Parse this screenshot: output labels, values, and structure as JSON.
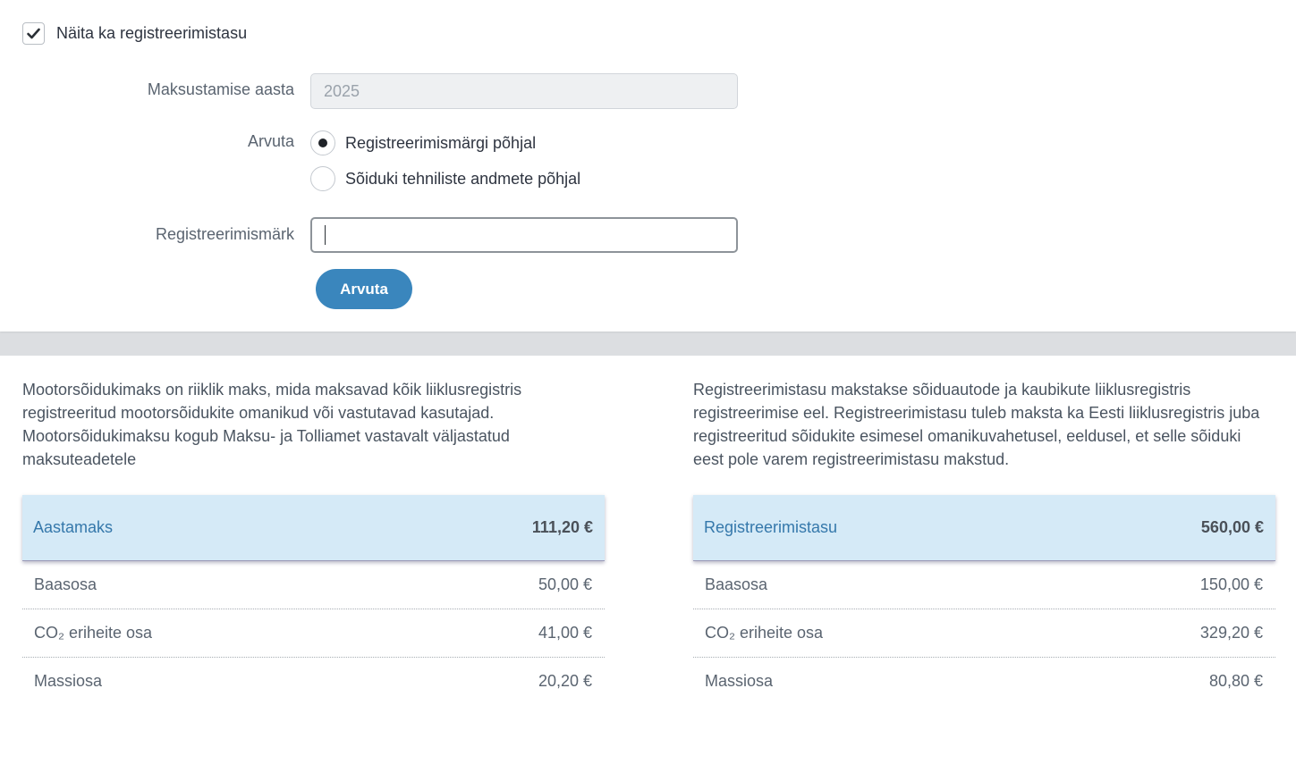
{
  "form": {
    "show_fee_checkbox": {
      "label": "Näita ka registreerimistasu",
      "checked": true
    },
    "tax_year": {
      "label": "Maksustamise aasta",
      "value": "2025"
    },
    "calculate_by": {
      "label": "Arvuta",
      "options": [
        {
          "label": "Registreerimismärgi põhjal",
          "selected": true
        },
        {
          "label": "Sõiduki tehniliste andmete põhjal",
          "selected": false
        }
      ]
    },
    "plate": {
      "label": "Registreerimismärk",
      "value": ""
    },
    "submit_label": "Arvuta"
  },
  "annual_tax": {
    "description": "Mootorsõidukimaks on riiklik maks, mida maksavad kõik liiklusregistris registreeritud mootorsõidukite omanikud või vastutavad kasutajad. Mootorsõidukimaksu kogub Maksu- ja Tolliamet vastavalt väljastatud maksuteadetele",
    "header": {
      "label": "Aastamaks",
      "value": "111,20 €"
    },
    "rows": [
      {
        "label": "Baasosa",
        "value": "50,00 €"
      },
      {
        "label": "CO₂ eriheite osa",
        "value": "41,00 €"
      },
      {
        "label": "Massiosa",
        "value": "20,20 €"
      }
    ]
  },
  "registration_fee": {
    "description": "Registreerimistasu makstakse sõiduautode ja kaubikute liiklusregistris registreerimise eel. Registreerimistasu tuleb maksta ka Eesti liiklusregistris juba registreeritud sõidukite esimesel omanikuvahetusel, eeldusel, et selle sõiduki eest pole varem registreerimistasu makstud.",
    "header": {
      "label": "Registreerimistasu",
      "value": "560,00 €"
    },
    "rows": [
      {
        "label": "Baasosa",
        "value": "150,00 €"
      },
      {
        "label": "CO₂ eriheite osa",
        "value": "329,20 €"
      },
      {
        "label": "Massiosa",
        "value": "80,80 €"
      }
    ]
  },
  "colors": {
    "accent": "#3a86bd",
    "header_bg": "#d5eaf7",
    "header_text": "#3578ab"
  }
}
